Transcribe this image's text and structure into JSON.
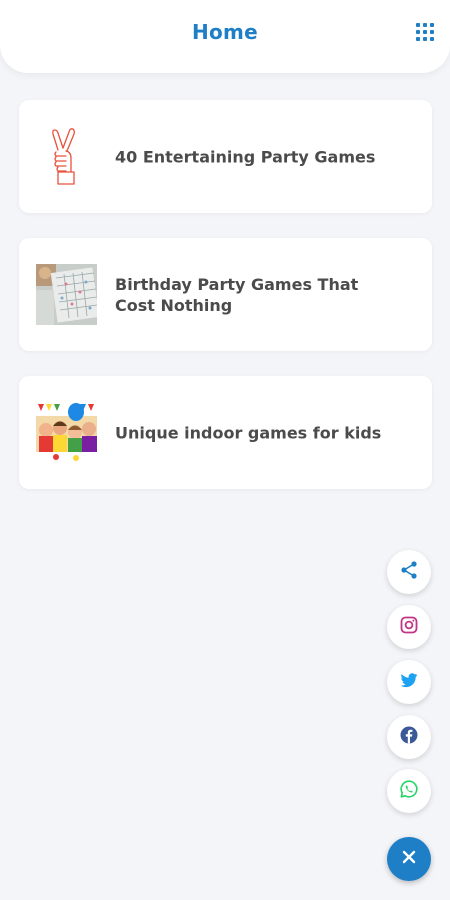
{
  "header": {
    "title": "Home"
  },
  "cards": [
    {
      "title": "40 Entertaining Party Games",
      "thumbnail": "crossed-fingers-icon"
    },
    {
      "title": "Birthday Party Games That Cost Nothing",
      "thumbnail": "board-game-photo"
    },
    {
      "title": "Unique indoor games for kids",
      "thumbnail": "kids-party-photo"
    }
  ],
  "share_buttons": [
    {
      "name": "share",
      "icon": "share-icon",
      "color": "#1e7fc6"
    },
    {
      "name": "instagram",
      "icon": "instagram-icon",
      "color": "#c13584"
    },
    {
      "name": "twitter",
      "icon": "twitter-icon",
      "color": "#1da1f2"
    },
    {
      "name": "facebook",
      "icon": "facebook-icon",
      "color": "#3b5998"
    },
    {
      "name": "whatsapp",
      "icon": "whatsapp-icon",
      "color": "#25d366"
    }
  ],
  "colors": {
    "accent": "#1e7fc6",
    "background": "#f4f5f9",
    "card_text": "#4b4b4b"
  }
}
